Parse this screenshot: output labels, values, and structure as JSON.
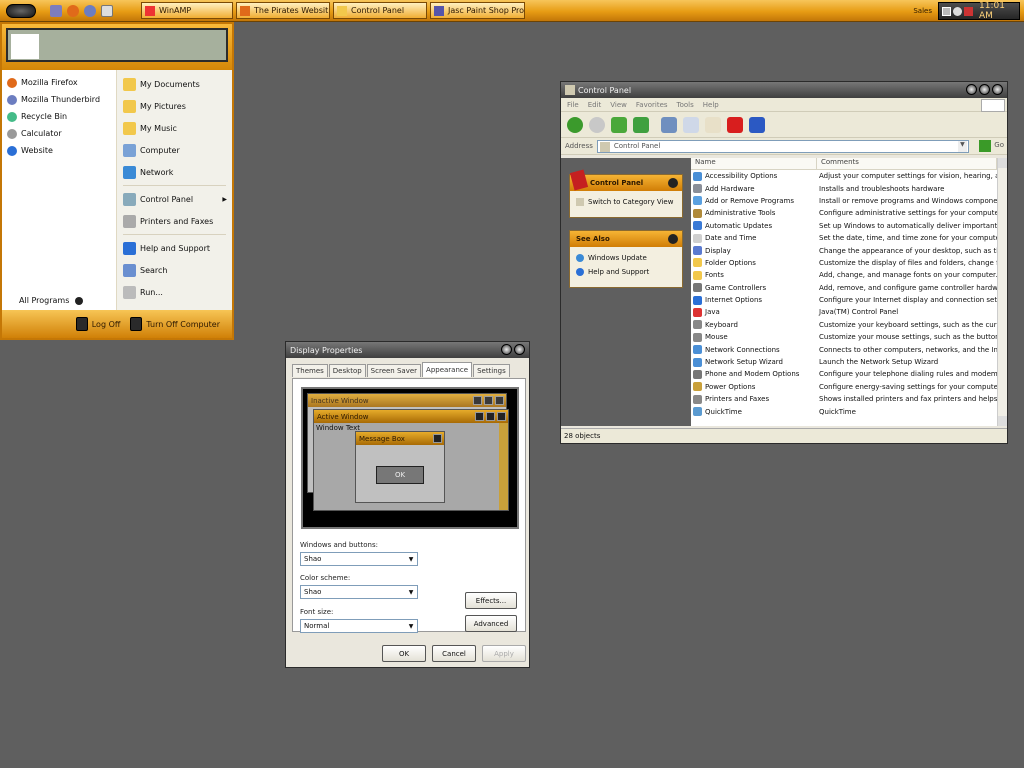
{
  "taskbar": {
    "tasks": [
      {
        "label": "WinAMP",
        "icon": "winamp-icon"
      },
      {
        "label": "The Pirates Websit...",
        "icon": "firefox-icon"
      },
      {
        "label": "Control Panel",
        "icon": "folder-icon"
      },
      {
        "label": "Jasc Paint Shop Pro",
        "icon": "paint-icon"
      }
    ],
    "tray": {
      "keyboard": "Sales",
      "clock": "11:01 AM"
    }
  },
  "start_menu": {
    "pinned": [
      {
        "label": "Mozilla Firefox",
        "icon": "firefox-icon"
      },
      {
        "label": "Mozilla Thunderbird",
        "icon": "thunderbird-icon"
      },
      {
        "label": "Recycle Bin",
        "icon": "recycle-bin-icon"
      },
      {
        "label": "Calculator",
        "icon": "calculator-icon"
      },
      {
        "label": "Website",
        "icon": "globe-icon"
      }
    ],
    "all_programs": "All Programs",
    "right": [
      {
        "label": "My Documents",
        "icon": "documents-icon"
      },
      {
        "label": "My Pictures",
        "icon": "pictures-icon"
      },
      {
        "label": "My Music",
        "icon": "music-icon"
      },
      {
        "label": "Computer",
        "icon": "computer-icon"
      },
      {
        "label": "Network",
        "icon": "network-icon"
      },
      {
        "label": "Control Panel",
        "icon": "control-panel-icon"
      },
      {
        "label": "Printers and Faxes",
        "icon": "printer-icon"
      },
      {
        "label": "Help and Support",
        "icon": "help-icon"
      },
      {
        "label": "Search",
        "icon": "search-icon"
      },
      {
        "label": "Run...",
        "icon": "run-icon"
      }
    ],
    "log_off": "Log Off",
    "turn_off": "Turn Off Computer"
  },
  "control_panel": {
    "title": "Control Panel",
    "menu": [
      "File",
      "Edit",
      "View",
      "Favorites",
      "Tools",
      "Help"
    ],
    "address_label": "Address",
    "address_value": "Control Panel",
    "go": "Go",
    "side_panel_title": "Control Panel",
    "side_panel_link": "Switch to Category View",
    "see_also_title": "See Also",
    "see_also": [
      "Windows Update",
      "Help and Support"
    ],
    "columns": [
      "Name",
      "Comments"
    ],
    "items": [
      {
        "name": "Accessibility Options",
        "comment": "Adjust your computer settings for vision, hearing, and mobi"
      },
      {
        "name": "Add Hardware",
        "comment": "Installs and troubleshoots hardware"
      },
      {
        "name": "Add or Remove Programs",
        "comment": "Install or remove programs and Windows components."
      },
      {
        "name": "Administrative Tools",
        "comment": "Configure administrative settings for your computer."
      },
      {
        "name": "Automatic Updates",
        "comment": "Set up Windows to automatically deliver important updates"
      },
      {
        "name": "Date and Time",
        "comment": "Set the date, time, and time zone for your computer."
      },
      {
        "name": "Display",
        "comment": "Change the appearance of your desktop, such as the backg"
      },
      {
        "name": "Folder Options",
        "comment": "Customize the display of files and folders, change file assoc"
      },
      {
        "name": "Fonts",
        "comment": "Add, change, and manage fonts on your computer."
      },
      {
        "name": "Game Controllers",
        "comment": "Add, remove, and configure game controller hardware such"
      },
      {
        "name": "Internet Options",
        "comment": "Configure your Internet display and connection settings."
      },
      {
        "name": "Java",
        "comment": "Java(TM) Control Panel"
      },
      {
        "name": "Keyboard",
        "comment": "Customize your keyboard settings, such as the cursor blink"
      },
      {
        "name": "Mouse",
        "comment": "Customize your mouse settings, such as the button configu"
      },
      {
        "name": "Network Connections",
        "comment": "Connects to other computers, networks, and the Internet."
      },
      {
        "name": "Network Setup Wizard",
        "comment": "Launch the Network Setup Wizard"
      },
      {
        "name": "Phone and Modem Options",
        "comment": "Configure your telephone dialing rules and modem settings."
      },
      {
        "name": "Power Options",
        "comment": "Configure energy-saving settings for your computer."
      },
      {
        "name": "Printers and Faxes",
        "comment": "Shows installed printers and fax printers and helps you add"
      },
      {
        "name": "QuickTime",
        "comment": "QuickTime"
      }
    ],
    "status": "28 objects"
  },
  "display_properties": {
    "title": "Display Properties",
    "tabs": [
      "Themes",
      "Desktop",
      "Screen Saver",
      "Appearance",
      "Settings"
    ],
    "preview": {
      "inactive": "Inactive Window",
      "active": "Active Window",
      "window_text": "Window Text",
      "message_box": "Message Box",
      "ok": "OK"
    },
    "windows_buttons_label": "Windows and buttons:",
    "windows_buttons_value": "Shao",
    "color_scheme_label": "Color scheme:",
    "color_scheme_value": "Shao",
    "font_size_label": "Font size:",
    "font_size_value": "Normal",
    "effects": "Effects...",
    "advanced": "Advanced",
    "ok": "OK",
    "cancel": "Cancel",
    "apply": "Apply"
  }
}
